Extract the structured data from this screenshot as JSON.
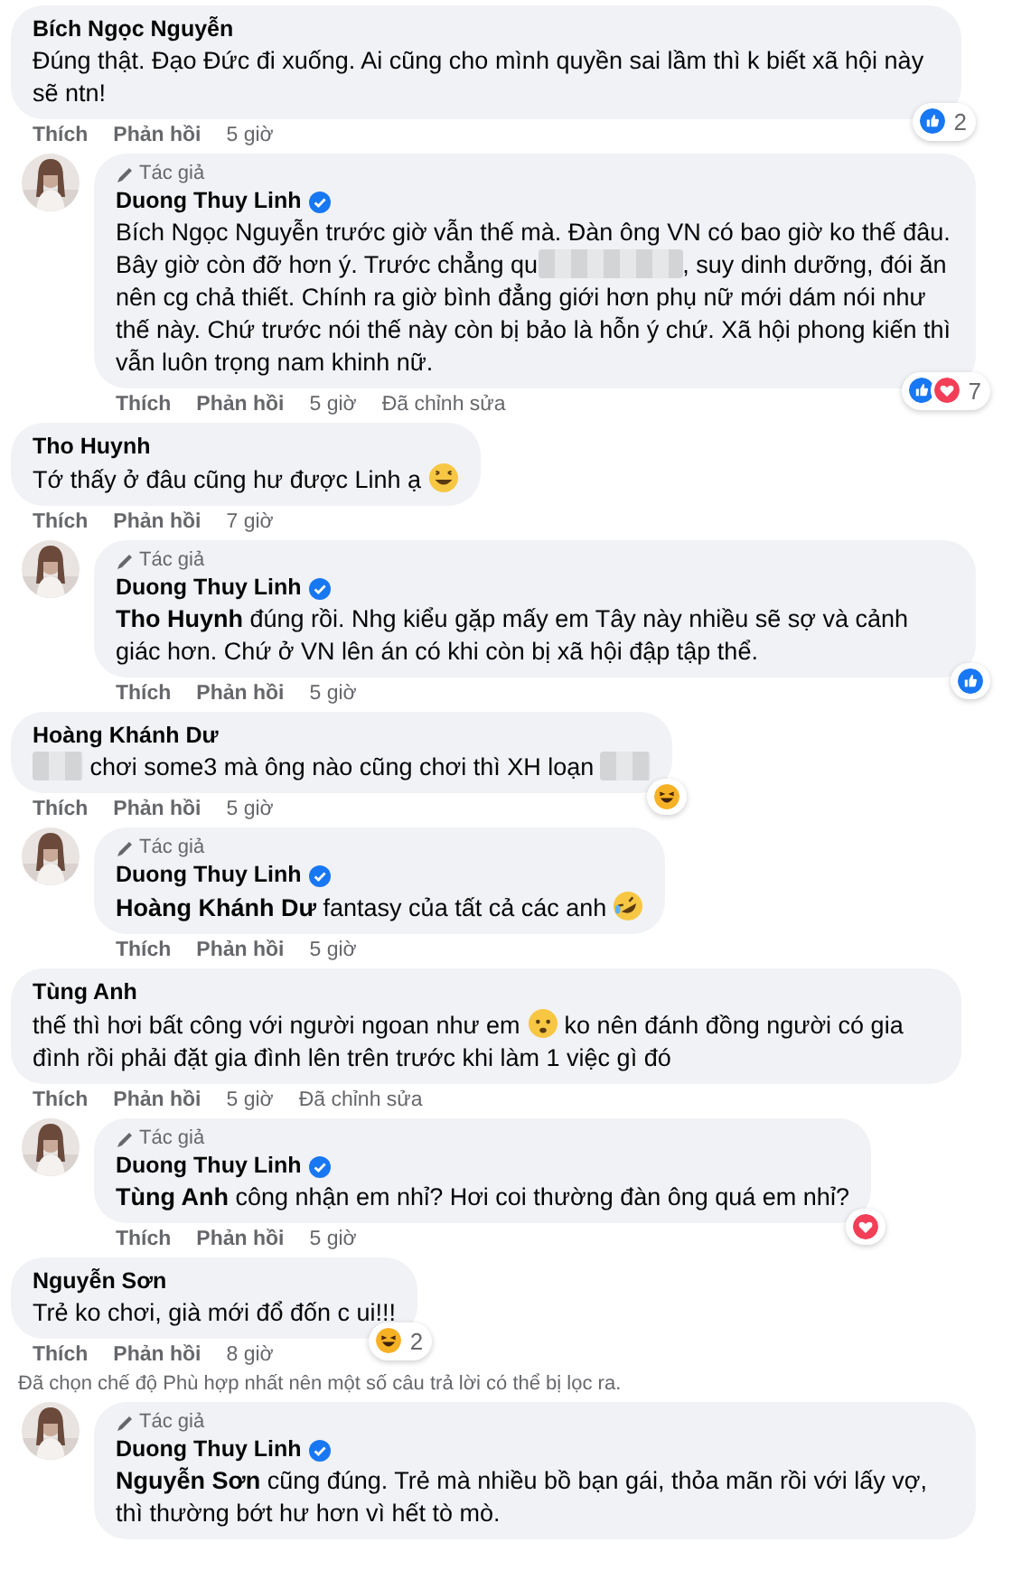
{
  "comments": [
    {
      "reply": false,
      "name": "Bích Ngọc Nguyễn",
      "body": [
        {
          "kind": "text",
          "text": "Đúng thật. Đạo Đức đi xuống. Ai cũng cho mình quyền sai lầm thì k biết xã hội này sẽ ntn!"
        }
      ],
      "actions": [
        "Thích",
        "Phản hồi"
      ],
      "time": "5 giờ",
      "reactions": {
        "types": [
          {
            "kind": "like"
          }
        ],
        "count": "2"
      }
    },
    {
      "reply": true,
      "author_label": "Tác giả",
      "name": "Duong Thuy Linh",
      "verified": true,
      "body": [
        {
          "kind": "text",
          "text": "Bích Ngọc Nguyễn trước giờ vẫn thế mà. Đàn ông VN có bao giờ ko thế đâu. Bây giờ còn đỡ hơn ý. Trước chẳng qu"
        },
        {
          "kind": "blur_long"
        },
        {
          "kind": "text",
          "text": ", suy dinh dưỡng, đói ăn nên cg chả thiết. Chính ra giờ bình đẳng giới hơn phụ nữ mới dám nói như thế này. Chứ trước nói thế này còn bị bảo là hỗn ý chứ. Xã hội phong kiến thì vẫn luôn trọng nam khinh nữ."
        }
      ],
      "actions": [
        "Thích",
        "Phản hồi"
      ],
      "time": "5 giờ",
      "edited": "Đã chỉnh sửa",
      "reactions": {
        "types": [
          {
            "kind": "like"
          },
          {
            "kind": "love"
          }
        ],
        "count": "7"
      }
    },
    {
      "reply": false,
      "name": "Tho Huynh",
      "body": [
        {
          "kind": "text",
          "text": "Tớ thấy ở đâu cũng hư được Linh ạ "
        },
        {
          "kind": "grin_emoji"
        }
      ],
      "actions": [
        "Thích",
        "Phản hồi"
      ],
      "time": "7 giờ"
    },
    {
      "reply": true,
      "author_label": "Tác giả",
      "name": "Duong Thuy Linh",
      "verified": true,
      "body": [
        {
          "kind": "mention",
          "text": "Tho Huynh"
        },
        {
          "kind": "text",
          "text": " đúng rồi. Nhg kiểu gặp mấy em Tây này nhiều sẽ sợ và cảnh giác hơn. Chứ ở VN lên án có khi còn bị xã hội đập tập thể."
        }
      ],
      "actions": [
        "Thích",
        "Phản hồi"
      ],
      "time": "5 giờ",
      "reactions": {
        "types": [
          {
            "kind": "like"
          }
        ]
      }
    },
    {
      "reply": false,
      "name": "Hoàng Khánh Dư",
      "body": [
        {
          "kind": "blur_short"
        },
        {
          "kind": "text",
          "text": " chơi some3 mà ông nào cũng chơi thì XH loạn "
        },
        {
          "kind": "blur_short"
        }
      ],
      "actions": [
        "Thích",
        "Phản hồi"
      ],
      "time": "5 giờ",
      "reactions": {
        "types": [
          {
            "kind": "haha"
          }
        ]
      }
    },
    {
      "reply": true,
      "author_label": "Tác giả",
      "name": "Duong Thuy Linh",
      "verified": true,
      "body": [
        {
          "kind": "mention",
          "text": "Hoàng Khánh Dư"
        },
        {
          "kind": "text",
          "text": " fantasy của tất cả các anh "
        },
        {
          "kind": "rofl_emoji"
        }
      ],
      "actions": [
        "Thích",
        "Phản hồi"
      ],
      "time": "5 giờ"
    },
    {
      "reply": false,
      "name": "Tùng Anh",
      "body": [
        {
          "kind": "text",
          "text": "thế thì hơi bất công với người ngoan như em "
        },
        {
          "kind": "frown_emoji"
        },
        {
          "kind": "text",
          "text": " ko nên đánh đồng người có gia đình rồi phải đặt gia đình lên trên trước khi làm 1 việc gì đó"
        }
      ],
      "actions": [
        "Thích",
        "Phản hồi"
      ],
      "time": "5 giờ",
      "edited": "Đã chỉnh sửa"
    },
    {
      "reply": true,
      "author_label": "Tác giả",
      "name": "Duong Thuy Linh",
      "verified": true,
      "body": [
        {
          "kind": "mention",
          "text": "Tùng Anh"
        },
        {
          "kind": "text",
          "text": " công nhận em nhỉ? Hơi coi thường đàn ông quá em nhỉ?"
        }
      ],
      "actions": [
        "Thích",
        "Phản hồi"
      ],
      "time": "5 giờ",
      "reactions": {
        "types": [
          {
            "kind": "love"
          }
        ]
      }
    },
    {
      "reply": false,
      "name": "Nguyễn Sơn",
      "body": [
        {
          "kind": "text",
          "text": "Trẻ ko chơi, già mới đổ đốn c ui!!!"
        }
      ],
      "actions": [
        "Thích",
        "Phản hồi"
      ],
      "time": "8 giờ",
      "reactions": {
        "types": [
          {
            "kind": "haha"
          }
        ],
        "count": "2"
      },
      "notice": "Đã chọn chế độ Phù hợp nhất nên một số câu trả lời có thể bị lọc ra."
    },
    {
      "reply": true,
      "author_label": "Tác giả",
      "name": "Duong Thuy Linh",
      "verified": true,
      "body": [
        {
          "kind": "mention",
          "text": "Nguyễn Sơn"
        },
        {
          "kind": "text",
          "text": " cũng đúng. Trẻ mà nhiều bồ bạn gái, thỏa mãn rồi với lấy vợ, thì thường bớt hư hơn vì hết tò mò."
        }
      ]
    }
  ]
}
